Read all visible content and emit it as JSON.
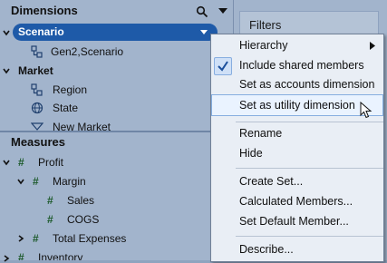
{
  "dimensions_panel": {
    "title": "Dimensions",
    "items": [
      {
        "label": "Scenario",
        "selected": true
      },
      {
        "label": "Gen2,Scenario"
      },
      {
        "label": "Market"
      },
      {
        "label": "Region"
      },
      {
        "label": "State"
      },
      {
        "label": "New Market"
      }
    ]
  },
  "measures_panel": {
    "title": "Measures",
    "items": [
      {
        "label": "Profit"
      },
      {
        "label": "Margin"
      },
      {
        "label": "Sales"
      },
      {
        "label": "COGS"
      },
      {
        "label": "Total Expenses"
      },
      {
        "label": "Inventory"
      }
    ]
  },
  "filters_panel": {
    "title": "Filters"
  },
  "context_menu": {
    "items": [
      {
        "label": "Hierarchy",
        "has_submenu": true
      },
      {
        "label": "Include shared members",
        "checked": true
      },
      {
        "label": "Set as accounts dimension"
      },
      {
        "label": "Set as utility dimension",
        "highlighted": true
      },
      {
        "label": "Rename"
      },
      {
        "label": "Hide"
      },
      {
        "label": "Create Set..."
      },
      {
        "label": "Calculated Members..."
      },
      {
        "label": "Set Default Member..."
      },
      {
        "label": "Describe..."
      }
    ]
  },
  "colors": {
    "pane_bg": "#a2b4cc",
    "selected_pill": "#1e5aa8",
    "menu_bg": "#e9eef5",
    "menu_highlight_border": "#86aee0"
  }
}
